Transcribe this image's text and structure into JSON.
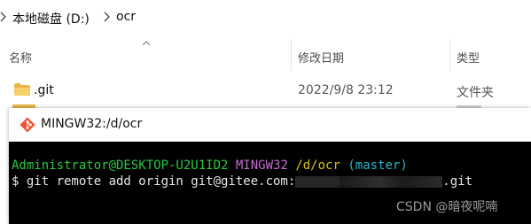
{
  "explorer": {
    "breadcrumb": {
      "drive": "本地磁盘 (D:)",
      "folder": "ocr"
    },
    "columns": {
      "name": "名称",
      "date": "修改日期",
      "type": "类型"
    },
    "rows": [
      {
        "name": ".git",
        "date": "2022/9/8 23:12",
        "type": "文件夹"
      }
    ],
    "folder_color": "#e9b64b"
  },
  "terminal": {
    "title": "MINGW32:/d/ocr",
    "prompt": {
      "user_host": "Administrator@DESKTOP-U2U1ID2",
      "env": "MINGW32",
      "path": "/d/ocr",
      "branch": "(master)"
    },
    "command_prefix": "$ git remote add origin git@gitee.com:",
    "command_suffix": ".git",
    "colors": {
      "user_host": "#27c93f",
      "env": "#c56ccf",
      "path": "#d8c01f",
      "branch": "#25b6cc"
    }
  },
  "watermark": "CSDN @暗夜呢喃"
}
